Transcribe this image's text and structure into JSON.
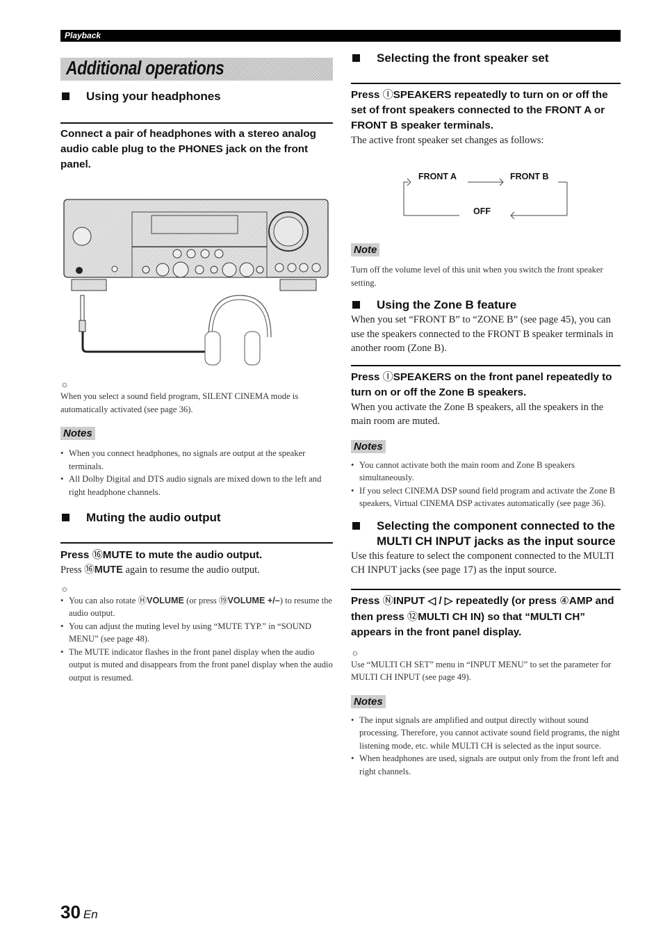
{
  "header": {
    "section": "Playback",
    "banner_title": "Additional operations"
  },
  "left": {
    "headphones": {
      "heading": "Using your headphones",
      "step": "Connect a pair of headphones with a stereo analog audio cable plug to the PHONES jack on the front panel.",
      "illustration_alt": "Receiver front panel with headphones connected to PHONES jack",
      "tip_icon": "lightbulb-tip-icon",
      "tip": "When you select a sound field program, SILENT CINEMA mode is automatically activated (see page 36).",
      "notes_label": "Notes",
      "notes": [
        "When you connect headphones, no signals are output at the speaker terminals.",
        "All Dolby Digital and DTS audio signals are mixed down to the left and right headphone channels."
      ]
    },
    "muting": {
      "heading": "Muting the audio output",
      "step_pre": "Press ",
      "step_num": "⑯",
      "step_key": "MUTE",
      "step_post": " to mute the audio output.",
      "body_pre": "Press ",
      "body_num": "⑯",
      "body_key": "MUTE",
      "body_post": " again to resume the audio output.",
      "tips": [
        {
          "pre": "You can also rotate ",
          "num1": "Ⓗ",
          "key1": "VOLUME",
          "mid": " (or press ",
          "num2": "⑲",
          "key2": "VOLUME +/–",
          "post": ") to resume the audio output."
        },
        {
          "text": "You can adjust the muting level by using “MUTE TYP.” in “SOUND MENU” (see page 48)."
        },
        {
          "text": "The MUTE indicator flashes in the front panel display when the audio output is muted and disappears from the front panel display when the audio output is resumed."
        }
      ]
    }
  },
  "right": {
    "front_speaker": {
      "heading": "Selecting the front speaker set",
      "step_pre": "Press ",
      "step_num": "Ⓘ",
      "step_key": "SPEAKERS",
      "step_post": " repeatedly to turn on or off the set of front speakers connected to the FRONT A or FRONT B speaker terminals.",
      "body": "The active front speaker set changes as follows:",
      "flow": {
        "a": "FRONT A",
        "b": "FRONT B",
        "off": "OFF"
      },
      "note_label": "Note",
      "note": "Turn off the volume level of this unit when you switch the front speaker setting."
    },
    "zone_b": {
      "heading": "Using the Zone B feature",
      "body": "When you set “FRONT B” to “ZONE B” (see page 45), you can use the speakers connected to the FRONT B speaker terminals in another room (Zone B).",
      "step_pre": "Press ",
      "step_num": "Ⓘ",
      "step_key": "SPEAKERS",
      "step_post": " on the front panel repeatedly to turn on or off the Zone B speakers.",
      "body2": "When you activate the Zone B speakers, all the speakers in the main room are muted.",
      "notes_label": "Notes",
      "notes": [
        "You cannot activate both the main room and Zone B speakers simultaneously.",
        "If you select CINEMA DSP sound field program and activate the Zone B speakers, Virtual CINEMA DSP activates automatically (see page 36)."
      ]
    },
    "multi_ch": {
      "heading": "Selecting the component connected to the MULTI CH INPUT jacks as the input source",
      "body": "Use this feature to select the component connected to the MULTI CH INPUT jacks (see page 17) as the input source.",
      "step_p1": "Press ",
      "step_n1": "Ⓝ",
      "step_k1": "INPUT",
      "step_p2": " ◁ / ▷ repeatedly (or press ",
      "step_n2": "④",
      "step_k2": "AMP",
      "step_p3": " and then press ",
      "step_n3": "⑫",
      "step_k3": "MULTI CH IN",
      "step_p4": ") so that “MULTI CH” appears in the front panel display.",
      "tip": "Use “MULTI CH SET” menu in “INPUT MENU” to set the parameter for MULTI CH INPUT (see page 49).",
      "notes_label": "Notes",
      "notes": [
        "The input signals are amplified and output directly without sound processing. Therefore, you cannot activate sound field programs, the night listening mode, etc. while MULTI CH is selected as the input source.",
        "When headphones are used, signals are output only from the front left and right channels."
      ]
    }
  },
  "footer": {
    "page_number": "30",
    "language": "En"
  }
}
